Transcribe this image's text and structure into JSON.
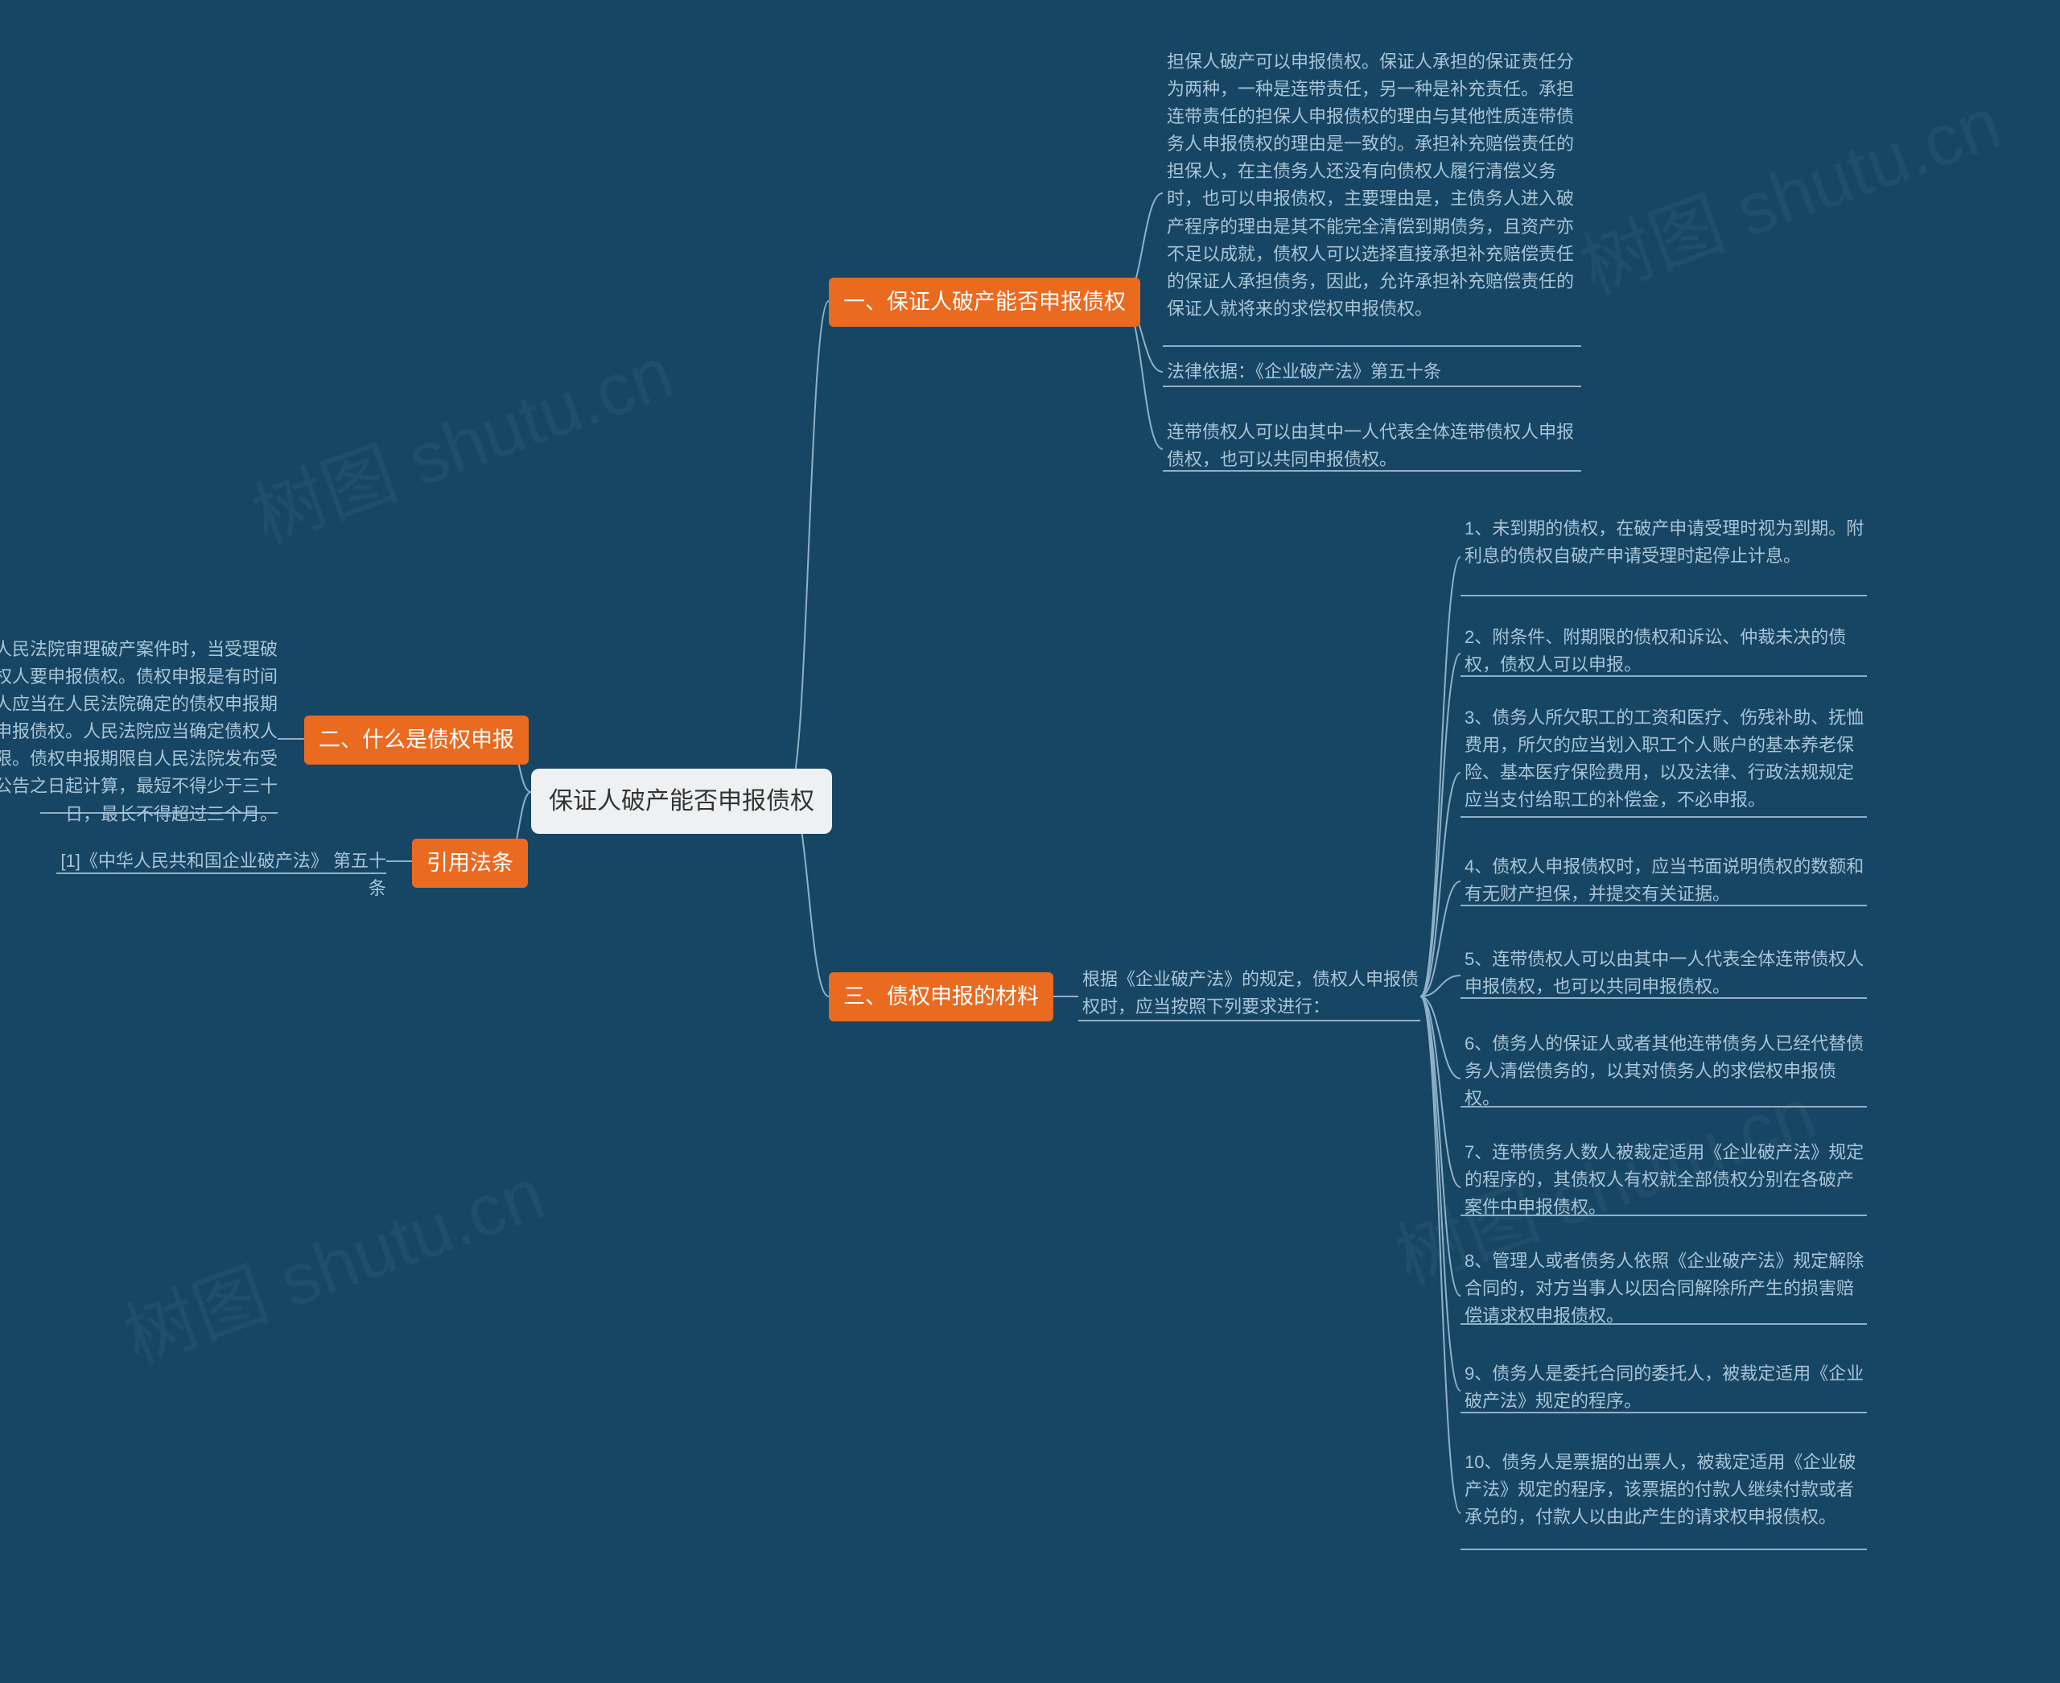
{
  "root": {
    "title": "保证人破产能否申报债权"
  },
  "branches": {
    "b1": {
      "label": "一、保证人破产能否申报债权"
    },
    "b2": {
      "label": "二、什么是债权申报"
    },
    "b3": {
      "label": "三、债权申报的材料"
    },
    "b4": {
      "label": "引用法条"
    }
  },
  "section1": {
    "p1": "担保人破产可以申报债权。保证人承担的保证责任分为两种，一种是连带责任，另一种是补充责任。承担连带责任的担保人申报债权的理由与其他性质连带债务人申报债权的理由是一致的。承担补充赔偿责任的担保人，在主债务人还没有向债权人履行清偿义务时，也可以申报债权，主要理由是，主债务人进入破产程序的理由是其不能完全清偿到期债务，且资产亦不足以成就，债权人可以选择直接承担补充赔偿责任的保证人承担债务，因此，允许承担补充赔偿责任的保证人就将来的求偿权申报债权。",
    "p2": "法律依据：《企业破产法》第五十条",
    "p3": "连带债权人可以由其中一人代表全体连带债权人申报债权，也可以共同申报债权。"
  },
  "section2": {
    "p1": "债权申报是指人民法院审理破产案件时，当受理破产申请后，债权人要申报债权。债权申报是有时间限制的。债权人应当在人民法院确定的债权申报期限内向管理人申报债权。人民法院应当确定债权人申报债权的期限。债权申报期限自人民法院发布受理破产申请公告之日起计算，最短不得少于三十日，最长不得超过三个月。"
  },
  "section3": {
    "intro": "根据《企业破产法》的规定，债权人申报债权时，应当按照下列要求进行：",
    "items": [
      "1、未到期的债权，在破产申请受理时视为到期。附利息的债权自破产申请受理时起停止计息。",
      "2、附条件、附期限的债权和诉讼、仲裁未决的债权，债权人可以申报。",
      "3、债务人所欠职工的工资和医疗、伤残补助、抚恤费用，所欠的应当划入职工个人账户的基本养老保险、基本医疗保险费用，以及法律、行政法规规定应当支付给职工的补偿金，不必申报。",
      "4、债权人申报债权时，应当书面说明债权的数额和有无财产担保，并提交有关证据。",
      "5、连带债权人可以由其中一人代表全体连带债权人申报债权，也可以共同申报债权。",
      "6、债务人的保证人或者其他连带债务人已经代替债务人清偿债务的，以其对债务人的求偿权申报债权。",
      "7、连带债务人数人被裁定适用《企业破产法》规定的程序的，其债权人有权就全部债权分别在各破产案件中申报债权。",
      "8、管理人或者债务人依照《企业破产法》规定解除合同的，对方当事人以因合同解除所产生的损害赔偿请求权申报债权。",
      "9、债务人是委托合同的委托人，被裁定适用《企业破产法》规定的程序。",
      "10、债务人是票据的出票人，被裁定适用《企业破产法》规定的程序，该票据的付款人继续付款或者承兑的，付款人以由此产生的请求权申报债权。"
    ]
  },
  "section4": {
    "citation": "[1]《中华人民共和国企业破产法》 第五十条"
  },
  "watermark": "树图 shutu.cn"
}
